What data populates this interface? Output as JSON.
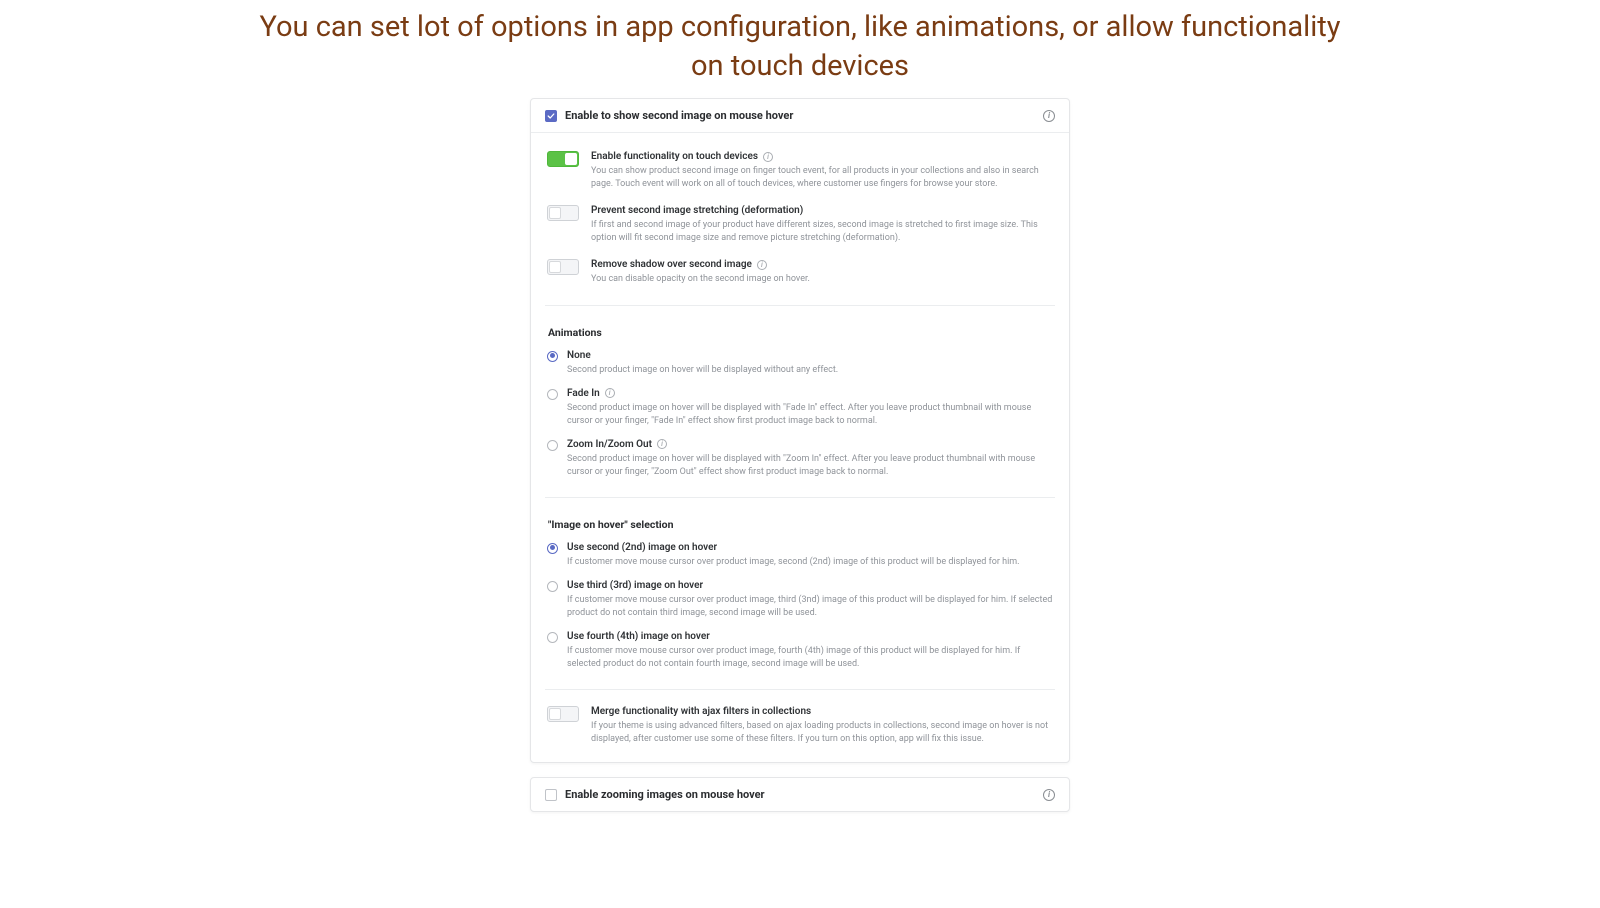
{
  "heading": "You can set lot of options in app configuration, like animations, or allow functionality on touch devices",
  "card_enable": {
    "header_label": "Enable to show second image on mouse hover",
    "toggles": {
      "touch": {
        "title": "Enable functionality on touch devices",
        "desc": "You can show product second image on finger touch event, for all products in your collections and also in search page. Touch event will work on all of touch devices, where customer use fingers for browse your store."
      },
      "stretch": {
        "title": "Prevent second image stretching (deformation)",
        "desc": "If first and second image of your product have different sizes, second image is stretched to first image size. This option will fit second image size and remove picture stretching (deformation)."
      },
      "shadow": {
        "title": "Remove shadow over second image",
        "desc": "You can disable opacity on the second image on hover."
      }
    },
    "animations_label": "Animations",
    "animations": {
      "none": {
        "title": "None",
        "desc": "Second product image on hover will be displayed without any effect."
      },
      "fade": {
        "title": "Fade In",
        "desc": "Second product image on hover will be displayed with \"Fade In\" effect. After you leave product thumbnail with mouse cursor or your finger, \"Fade In\" effect show first product image back to normal."
      },
      "zoom": {
        "title": "Zoom In/Zoom Out",
        "desc": "Second product image on hover will be displayed with \"Zoom In\" effect. After you leave product thumbnail with mouse cursor or your finger, \"Zoom Out\" effect show first product image back to normal."
      }
    },
    "selection_label": "\"Image on hover\" selection",
    "selection": {
      "second": {
        "title": "Use second (2nd) image on hover",
        "desc": "If customer move mouse cursor over product image, second (2nd) image of this product will be displayed for him."
      },
      "third": {
        "title": "Use third (3rd) image on hover",
        "desc": "If customer move mouse cursor over product image, third (3nd) image of this product will be displayed for him. If selected product do not contain third image, second image will be used."
      },
      "fourth": {
        "title": "Use fourth (4th) image on hover",
        "desc": "If customer move mouse cursor over product image, fourth (4th) image of this product will be displayed for him. If selected product do not contain fourth image, second image will be used."
      }
    },
    "merge": {
      "title": "Merge functionality with ajax filters in collections",
      "desc": "If your theme is using advanced filters, based on ajax loading products in collections, second image on hover is not displayed, after customer use some of these filters. If you turn on this option, app will fix this issue."
    }
  },
  "card_zoom": {
    "header_label": "Enable zooming images on mouse hover"
  }
}
